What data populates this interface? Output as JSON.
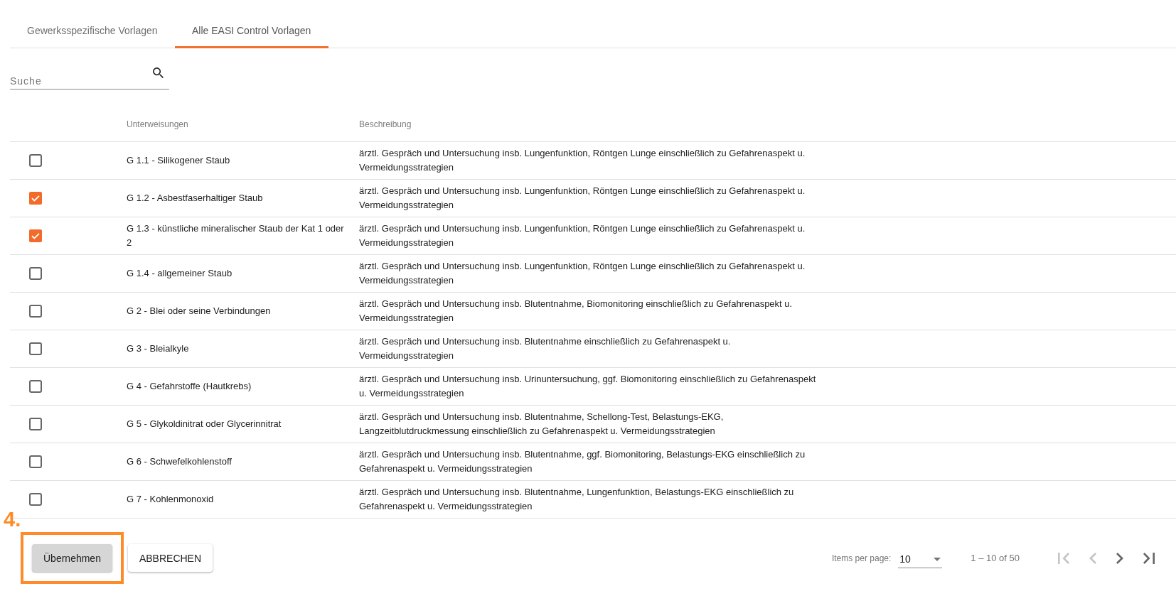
{
  "tabs": [
    {
      "label": "Gewerksspezifische Vorlagen",
      "selected": false
    },
    {
      "label": "Alle EASI Control Vorlagen",
      "selected": true
    }
  ],
  "search": {
    "placeholder": "Suche"
  },
  "table": {
    "columns": [
      "Unterweisungen",
      "Beschreibung"
    ],
    "rows": [
      {
        "checked": false,
        "name": "G 1.1 - Silikogener Staub",
        "description": "ärztl. Gespräch und Untersuchung insb. Lungenfunktion, Röntgen Lunge einschließlich zu Gefahrenaspekt u. Vermeidungsstrategien"
      },
      {
        "checked": true,
        "name": "G 1.2 - Asbestfaserhaltiger Staub",
        "description": "ärztl. Gespräch und Untersuchung insb. Lungenfunktion, Röntgen Lunge einschließlich zu Gefahrenaspekt u. Vermeidungsstrategien"
      },
      {
        "checked": true,
        "name": "G 1.3 - künstliche mineralischer Staub der Kat 1 oder 2",
        "description": "ärztl. Gespräch und Untersuchung insb. Lungenfunktion, Röntgen Lunge einschließlich zu Gefahrenaspekt u. Vermeidungsstrategien"
      },
      {
        "checked": false,
        "name": "G 1.4 - allgemeiner Staub",
        "description": "ärztl. Gespräch und Untersuchung insb. Lungenfunktion, Röntgen Lunge einschließlich zu Gefahrenaspekt u. Vermeidungsstrategien"
      },
      {
        "checked": false,
        "name": "G 2 - Blei oder seine Verbindungen",
        "description": "ärztl. Gespräch und Untersuchung insb. Blutentnahme, Biomonitoring einschließlich zu Gefahrenaspekt u. Vermeidungsstrategien"
      },
      {
        "checked": false,
        "name": "G 3 - Bleialkyle",
        "description": "ärztl. Gespräch und Untersuchung insb. Blutentnahme einschließlich zu Gefahrenaspekt u. Vermeidungsstrategien"
      },
      {
        "checked": false,
        "name": "G 4 - Gefahrstoffe (Hautkrebs)",
        "description": "ärztl. Gespräch und Untersuchung insb. Urinuntersuchung, ggf. Biomonitoring einschließlich zu Gefahrenaspekt u. Vermeidungsstrategien"
      },
      {
        "checked": false,
        "name": "G 5 - Glykoldinitrat oder Glycerinnitrat",
        "description": "ärztl. Gespräch und Untersuchung insb. Blutentnahme, Schellong-Test, Belastungs-EKG, Langzeitblutdruckmessung einschließlich zu Gefahrenaspekt u. Vermeidungsstrategien"
      },
      {
        "checked": false,
        "name": "G 6 - Schwefelkohlenstoff",
        "description": "ärztl. Gespräch und Untersuchung insb. Blutentnahme, ggf. Biomonitoring, Belastungs-EKG einschließlich zu Gefahrenaspekt u. Vermeidungsstrategien"
      },
      {
        "checked": false,
        "name": "G 7 - Kohlenmonoxid",
        "description": "ärztl. Gespräch und Untersuchung insb. Blutentnahme, Lungenfunktion, Belastungs-EKG einschließlich zu Gefahrenaspekt u. Vermeidungsstrategien"
      }
    ]
  },
  "actions": [
    {
      "label": "Übernehmen",
      "kind": "primary",
      "annotation": "4."
    },
    {
      "label": "ABBRECHEN",
      "kind": "secondary"
    }
  ],
  "paginator": {
    "items_per_page_label": "Items per page:",
    "page_size": "10",
    "range": "1 – 10 of 50",
    "nav": [
      {
        "kind": "first",
        "disabled": true
      },
      {
        "kind": "previous",
        "disabled": true
      },
      {
        "kind": "next",
        "disabled": false
      },
      {
        "kind": "last",
        "disabled": false
      }
    ]
  }
}
